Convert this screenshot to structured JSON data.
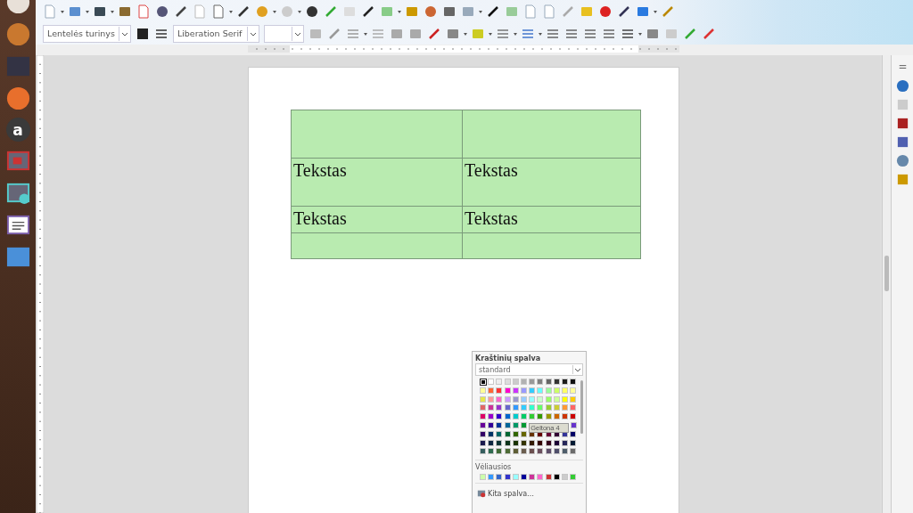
{
  "launcher": {
    "store_letter": "a"
  },
  "toolbar": {
    "paragraph_style": "Lentelės turinys",
    "font_name": "Liberation Serif"
  },
  "table": {
    "rows": [
      {
        "cells": [
          {},
          {}
        ]
      },
      {
        "cells": [
          {
            "text": "Tekstas"
          },
          {
            "text": "Tekstas"
          }
        ]
      },
      {
        "cells": [
          {
            "text": "Tekstas"
          },
          {
            "text": "Tekstas"
          }
        ]
      },
      {
        "cells": [
          {},
          {}
        ]
      }
    ]
  },
  "color_popup": {
    "title": "Kraštinių spalva",
    "palette_name": "standard",
    "palette": [
      {
        "swatches": [
          {
            "color": "#000000",
            "selected": true
          },
          {
            "color": "#ffffff",
            "selected": false
          },
          {
            "color": "#eeeeee",
            "selected": false
          },
          {
            "color": "#dddddd",
            "selected": false
          },
          {
            "color": "#cccccc",
            "selected": false
          },
          {
            "color": "#b2b2b2",
            "selected": false
          },
          {
            "color": "#999999",
            "selected": false
          },
          {
            "color": "#808080",
            "selected": false
          },
          {
            "color": "#666666",
            "selected": false
          },
          {
            "color": "#333333",
            "selected": false
          },
          {
            "color": "#1c1c1c",
            "selected": false
          },
          {
            "color": "#111111",
            "selected": false
          }
        ]
      },
      {
        "swatches": [
          {
            "color": "#ffff99",
            "selected": false
          },
          {
            "color": "#ff6633",
            "selected": false
          },
          {
            "color": "#ff3333",
            "selected": false
          },
          {
            "color": "#ff00cc",
            "selected": false
          },
          {
            "color": "#cc33ff",
            "selected": false
          },
          {
            "color": "#9999ff",
            "selected": false
          },
          {
            "color": "#33ccff",
            "selected": false
          },
          {
            "color": "#66ffff",
            "selected": false
          },
          {
            "color": "#99ff99",
            "selected": false
          },
          {
            "color": "#ccff66",
            "selected": false
          },
          {
            "color": "#ffff66",
            "selected": false
          },
          {
            "color": "#ffff99",
            "selected": false
          }
        ]
      },
      {
        "swatches": [
          {
            "color": "#e6e64c",
            "selected": false
          },
          {
            "color": "#ff9999",
            "selected": false
          },
          {
            "color": "#ff66cc",
            "selected": false
          },
          {
            "color": "#cc99ff",
            "selected": false
          },
          {
            "color": "#9999cc",
            "selected": false
          },
          {
            "color": "#99ccff",
            "selected": false
          },
          {
            "color": "#99ffff",
            "selected": false
          },
          {
            "color": "#ccffcc",
            "selected": false
          },
          {
            "color": "#99ff66",
            "selected": false
          },
          {
            "color": "#ccff99",
            "selected": false
          },
          {
            "color": "#ffff00",
            "selected": false
          },
          {
            "color": "#ffcc00",
            "selected": false
          }
        ]
      },
      {
        "swatches": [
          {
            "color": "#e06666",
            "selected": false
          },
          {
            "color": "#cc3399",
            "selected": false
          },
          {
            "color": "#9933cc",
            "selected": false
          },
          {
            "color": "#6666cc",
            "selected": false
          },
          {
            "color": "#3399ff",
            "selected": false
          },
          {
            "color": "#33ccff",
            "selected": false
          },
          {
            "color": "#33ffcc",
            "selected": false
          },
          {
            "color": "#66ff66",
            "selected": false
          },
          {
            "color": "#99cc33",
            "selected": false
          },
          {
            "color": "#cccc33",
            "selected": false
          },
          {
            "color": "#ff9933",
            "selected": false
          },
          {
            "color": "#ff6666",
            "selected": false
          }
        ]
      },
      {
        "swatches": [
          {
            "color": "#dd0066",
            "selected": false
          },
          {
            "color": "#9900cc",
            "selected": false
          },
          {
            "color": "#3300cc",
            "selected": false
          },
          {
            "color": "#0066cc",
            "selected": false
          },
          {
            "color": "#00cccc",
            "selected": false
          },
          {
            "color": "#00cc66",
            "selected": false
          },
          {
            "color": "#33cc33",
            "selected": false
          },
          {
            "color": "#339900",
            "selected": false
          },
          {
            "color": "#999900",
            "selected": false
          },
          {
            "color": "#cc6600",
            "selected": false
          },
          {
            "color": "#cc3300",
            "selected": false
          },
          {
            "color": "#cc0000",
            "selected": false
          }
        ]
      },
      {
        "swatches": [
          {
            "color": "#660099",
            "selected": false
          },
          {
            "color": "#330099",
            "selected": false
          },
          {
            "color": "#003399",
            "selected": false
          },
          {
            "color": "#006699",
            "selected": false
          },
          {
            "color": "#009966",
            "selected": false
          },
          {
            "color": "#009933",
            "selected": false
          }
        ],
        "swatches_after": [
          {
            "color": "#6633cc",
            "selected": false
          }
        ]
      },
      {
        "swatches": [
          {
            "color": "#330066",
            "selected": false
          },
          {
            "color": "#003366",
            "selected": false
          },
          {
            "color": "#006666",
            "selected": false
          },
          {
            "color": "#006633",
            "selected": false
          },
          {
            "color": "#336600",
            "selected": false
          },
          {
            "color": "#666600",
            "selected": false
          },
          {
            "color": "#663300",
            "selected": false
          },
          {
            "color": "#660000",
            "selected": false
          },
          {
            "color": "#660033",
            "selected": false
          },
          {
            "color": "#330033",
            "selected": false
          },
          {
            "color": "#333399",
            "selected": false
          },
          {
            "color": "#000066",
            "selected": false
          }
        ]
      },
      {
        "swatches": [
          {
            "color": "#1a1a4d",
            "selected": false
          },
          {
            "color": "#0d2640",
            "selected": false
          },
          {
            "color": "#0d3333",
            "selected": false
          },
          {
            "color": "#0d331a",
            "selected": false
          },
          {
            "color": "#1a3300",
            "selected": false
          },
          {
            "color": "#333300",
            "selected": false
          },
          {
            "color": "#331a00",
            "selected": false
          },
          {
            "color": "#330000",
            "selected": false
          },
          {
            "color": "#33001a",
            "selected": false
          },
          {
            "color": "#1a0033",
            "selected": false
          },
          {
            "color": "#262659",
            "selected": false
          },
          {
            "color": "#001a33",
            "selected": false
          }
        ]
      },
      {
        "swatches": [
          {
            "color": "#355e5e",
            "selected": false
          },
          {
            "color": "#2e6b4f",
            "selected": false
          },
          {
            "color": "#3f6b35",
            "selected": false
          },
          {
            "color": "#4d6b35",
            "selected": false
          },
          {
            "color": "#5e5e35",
            "selected": false
          },
          {
            "color": "#6b5e4f",
            "selected": false
          },
          {
            "color": "#6b4f4f",
            "selected": false
          },
          {
            "color": "#6b4f5e",
            "selected": false
          },
          {
            "color": "#5e4f6b",
            "selected": false
          },
          {
            "color": "#4f4f6b",
            "selected": false
          },
          {
            "color": "#4f5e6b",
            "selected": false
          },
          {
            "color": "#6b6b6b",
            "selected": false
          }
        ]
      }
    ],
    "tooltip": "Geltona 4",
    "recent_label": "Vėliausios",
    "recent": [
      {
        "color": "#ccffaa"
      },
      {
        "color": "#3399ff"
      },
      {
        "color": "#3366cc"
      },
      {
        "color": "#3333cc"
      },
      {
        "color": "#99ffff"
      },
      {
        "color": "#000099"
      },
      {
        "color": "#cc3399"
      },
      {
        "color": "#ff66cc"
      },
      {
        "color": "#cc3333"
      },
      {
        "color": "#000000"
      },
      {
        "color": "#cccccc"
      },
      {
        "color": "#33cc33"
      }
    ],
    "more_button": "Kita spalva…"
  }
}
